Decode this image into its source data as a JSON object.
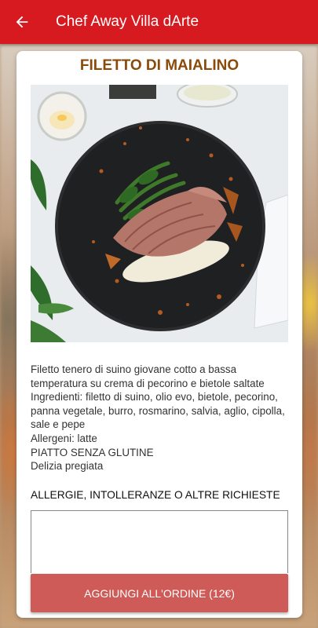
{
  "appbar": {
    "title": "Chef Away Villa dArte",
    "back_icon": "arrow-left-icon"
  },
  "dish": {
    "name": "FILETTO DI MAIALINO",
    "image_icon": "dish-photo",
    "description_lines": [
      "Filetto tenero di suino giovane cotto a bassa temperatura su crema di pecorino e bietole saltate",
      "Ingredienti: filetto di suino, olio evo, bietole, pecorino, panna vegetale, burro, rosmarino, salvia, aglio, cipolla, sale e pepe",
      "Allergeni: latte",
      "PIATTO SENZA GLUTINE",
      "Delizia pregiata"
    ]
  },
  "notes": {
    "label": "ALLERGIE, INTOLLERANZE O ALTRE RICHIESTE",
    "value": ""
  },
  "order": {
    "button_label": "AGGIUNGI ALL'ORDINE (12€)"
  },
  "colors": {
    "appbar": "#d71920",
    "title": "#8a4a0a",
    "button": "#cf5b58"
  }
}
